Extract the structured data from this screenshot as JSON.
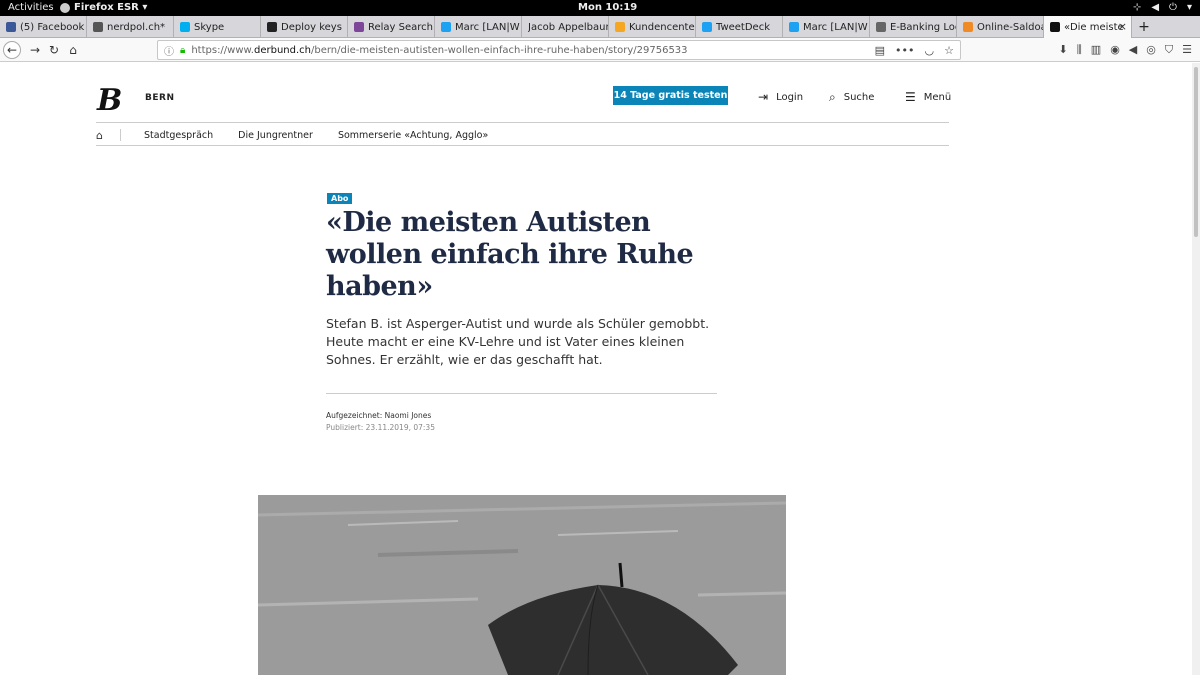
{
  "system_bar": {
    "activities": "Activities",
    "app_name": "Firefox ESR ▾",
    "clock": "Mon 10:19"
  },
  "tabs": [
    {
      "label": "(5) Facebook",
      "color": "#3b5998"
    },
    {
      "label": "nerdpol.ch*",
      "color": "#555555"
    },
    {
      "label": "Skype",
      "color": "#00aff0"
    },
    {
      "label": "Deploy keys",
      "color": "#222222"
    },
    {
      "label": "Relay Search: ",
      "color": "#7d4698"
    },
    {
      "label": "Marc [LAN|W",
      "color": "#1da1f2"
    },
    {
      "label": "Jacob Appelbaum",
      "color": "#dddddd"
    },
    {
      "label": "Kundencenter",
      "color": "#f5a623"
    },
    {
      "label": "TweetDeck",
      "color": "#1da1f2"
    },
    {
      "label": "Marc [LAN|W",
      "color": "#1da1f2"
    },
    {
      "label": "E-Banking Log",
      "color": "#666666"
    },
    {
      "label": "Online-Saldoa",
      "color": "#f08a24"
    },
    {
      "label": "«Die meiste",
      "color": "#111111"
    }
  ],
  "navbar": {
    "url_prefix": "https://www.",
    "url_host": "derbund.ch",
    "url_path": "/bern/die-meisten-autisten-wollen-einfach-ihre-ruhe-haben/story/29756533"
  },
  "site": {
    "logo": "B",
    "region": "BERN",
    "trial_button": "14 Tage gratis testen",
    "login": "Login",
    "search": "Suche",
    "menu": "Menü",
    "subnav": [
      "Stadtgespräch",
      "Die Jungrentner",
      "Sommerserie «Achtung, Agglo»"
    ]
  },
  "article": {
    "badge": "Abo",
    "headline": "«Die meisten Autisten wollen einfach ihre Ruhe haben»",
    "lead": "Stefan B. ist Asperger-Autist und wurde als Schüler gemobbt. Heute macht er eine KV-Lehre und ist Vater eines kleinen Sohnes. Er erzählt, wie er das geschafft hat.",
    "byline": "Aufgezeichnet: Naomi Jones",
    "published": "Publiziert: 23.11.2019, 07:35"
  },
  "colors": {
    "accent": "#0b84b7",
    "headline": "#1f2a44"
  }
}
